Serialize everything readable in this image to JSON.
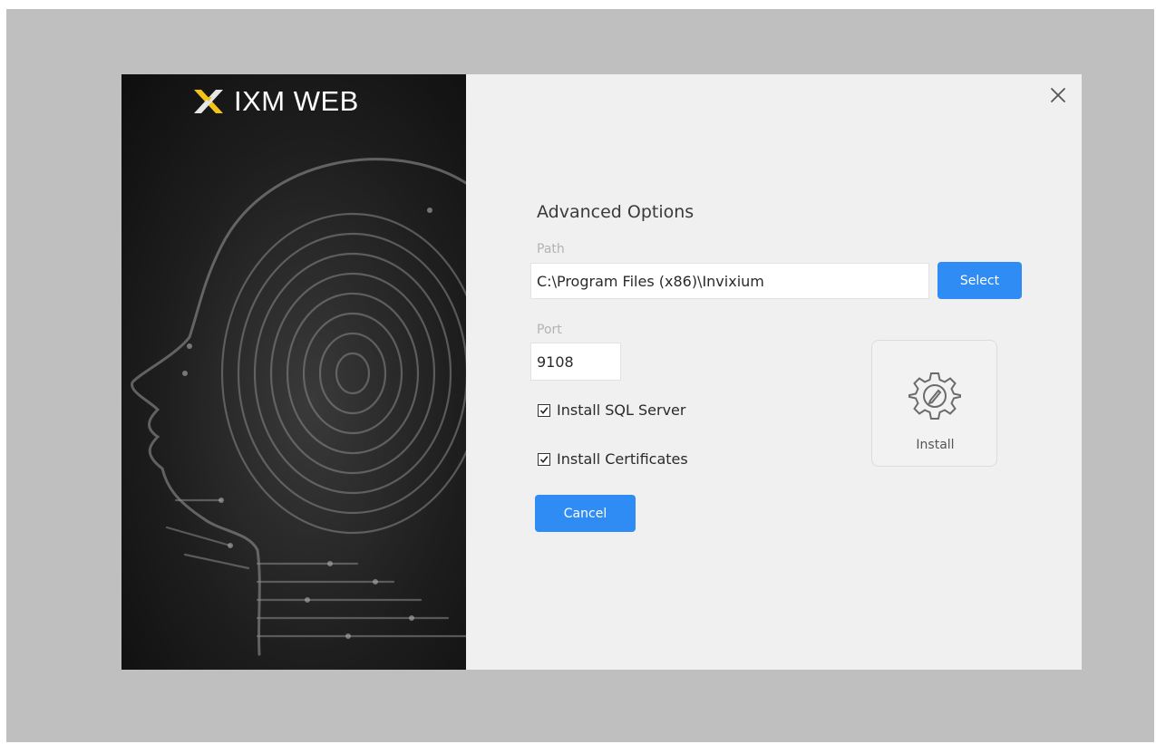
{
  "app": {
    "title": "IXM WEB"
  },
  "form": {
    "title": "Advanced Options",
    "path_label": "Path",
    "path_value": "C:\\Program Files (x86)\\Invixium",
    "select_label": "Select",
    "port_label": "Port",
    "port_value": "9108",
    "checkboxes": [
      {
        "label": "Install SQL Server",
        "checked": true
      },
      {
        "label": "Install Certificates",
        "checked": true
      }
    ],
    "cancel_label": "Cancel"
  },
  "install": {
    "label": "Install",
    "icon": "gear-icon"
  },
  "colors": {
    "accent": "#2f8cf4",
    "logo_gold": "#f3c316",
    "panel_dark": "#1a1a1a"
  }
}
